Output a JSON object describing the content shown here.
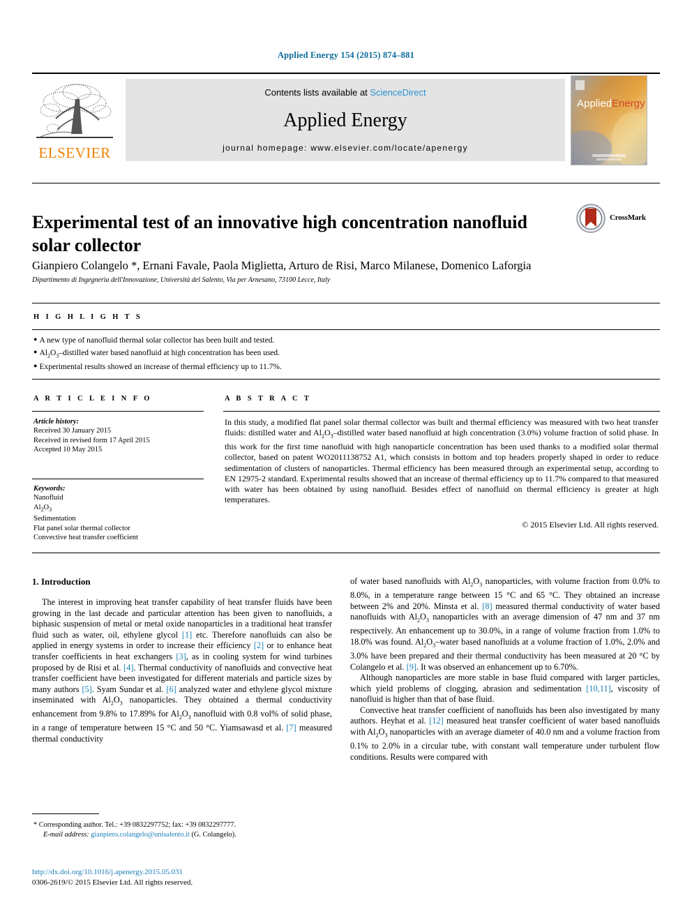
{
  "running_head": "Applied Energy 154 (2015) 874–881",
  "masthead": {
    "contents_prefix": "Contents lists available at ",
    "sciencedirect": "ScienceDirect",
    "journal_title": "Applied Energy",
    "homepage": "journal homepage: www.elsevier.com/locate/apenergy",
    "publisher_logo_text": "ELSEVIER",
    "cover_title_a": "Applied",
    "cover_title_b": "Energy"
  },
  "article": {
    "title": "Experimental test of an innovative high concentration nanofluid solar collector",
    "crossmark_label": "CrossMark",
    "authors": "Gianpiero Colangelo *, Ernani Favale, Paola Miglietta, Arturo de Risi, Marco Milanese, Domenico Laforgia",
    "affiliation": "Dipartimento di Ingegneria dell'Innovazione, Università del Salento, Via per Arnesano, 73100 Lecce, Italy"
  },
  "highlights": {
    "heading": "H I G H L I G H T S",
    "items": [
      "A new type of nanofluid thermal solar collector has been built and tested.",
      "Al2O3–distilled water based nanofluid at high concentration has been used.",
      "Experimental results showed an increase of thermal efficiency up to 11.7%."
    ]
  },
  "article_info": {
    "heading": "A R T I C L E   I N F O",
    "history_label": "Article history:",
    "history": [
      "Received 30 January 2015",
      "Received in revised form 17 April 2015",
      "Accepted 10 May 2015"
    ],
    "keywords_label": "Keywords:",
    "keywords": [
      "Nanofluid",
      "Al2O3",
      "Sedimentation",
      "Flat panel solar thermal collector",
      "Convective heat transfer coefficient"
    ]
  },
  "abstract": {
    "heading": "A B S T R A C T",
    "text": "In this study, a modified flat panel solar thermal collector was built and thermal efficiency was measured with two heat transfer fluids: distilled water and Al2O3–distilled water based nanofluid at high concentration (3.0%) volume fraction of solid phase. In this work for the first time nanofluid with high nanoparticle concentration has been used thanks to a modified solar thermal collector, based on patent WO2011138752 A1, which consists in bottom and top headers properly shaped in order to reduce sedimentation of clusters of nanoparticles. Thermal efficiency has been measured through an experimental setup, according to EN 12975-2 standard. Experimental results showed that an increase of thermal efficiency up to 11.7% compared to that measured with water has been obtained by using nanofluid. Besides effect of nanofluid on thermal efficiency is greater at high temperatures.",
    "copyright": "© 2015 Elsevier Ltd. All rights reserved."
  },
  "body": {
    "section_title": "1. Introduction",
    "left_paragraph_1": "The interest in improving heat transfer capability of heat transfer fluids have been growing in the last decade and particular attention has been given to nanofluids, a biphasic suspension of metal or metal oxide nanoparticles in a traditional heat transfer fluid such as water, oil, ethylene glycol [1] etc. Therefore nanofluids can also be applied in energy systems in order to increase their efficiency [2] or to enhance heat transfer coefficients in heat exchangers [3], as in cooling system for wind turbines proposed by de Risi et al. [4]. Thermal conductivity of nanofluids and convective heat transfer coefficient have been investigated for different materials and particle sizes by many authors [5]. Syam Sundar et al. [6] analyzed water and ethylene glycol mixture inseminated with Al2O3 nanoparticles. They obtained a thermal conductivity enhancement from 9.8% to 17.89% for Al2O3 nanofluid with 0.8 vol% of solid phase, in a range of temperature between 15 °C and 50 °C. Yiamsawasd et al. [7] measured thermal conductivity",
    "right_paragraph_1": "of water based nanofluids with Al2O3 nanoparticles, with volume fraction from 0.0% to 8.0%, in a temperature range between 15 °C and 65 °C. They obtained an increase between 2% and 20%. Minsta et al. [8] measured thermal conductivity of water based nanofluids with Al2O3 nanoparticles with an average dimension of 47 nm and 37 nm respectively. An enhancement up to 30.0%, in a range of volume fraction from 1.0% to 18.0% was found. Al2O3–water based nanofluids at a volume fraction of 1.0%, 2.0% and 3.0% have been prepared and their thermal conductivity has been measured at 20 °C by Colangelo et al. [9]. It was observed an enhancement up to 6.70%.",
    "right_paragraph_2": "Although nanoparticles are more stable in base fluid compared with larger particles, which yield problems of clogging, abrasion and sedimentation [10,11], viscosity of nanofluid is higher than that of base fluid.",
    "right_paragraph_3": "Convective heat transfer coefficient of nanofluids has been also investigated by many authors. Heyhat et al. [12] measured heat transfer coefficient of water based nanofluids with Al2O3 nanoparticles with an average diameter of 40.0 nm and a volume fraction from 0.1% to 2.0% in a circular tube, with constant wall temperature under turbulent flow conditions. Results were compared with"
  },
  "footnote": {
    "corresponding": "* Corresponding author. Tel.: +39 0832297752; fax: +39 0832297777.",
    "email_label": "E-mail address:",
    "email": "gianpiero.colangelo@unisalento.it",
    "email_suffix": "(G. Colangelo).",
    "doi": "http://dx.doi.org/10.1016/j.apenergy.2015.05.031",
    "issn_line": "0306-2619/© 2015 Elsevier Ltd. All rights reserved."
  },
  "colors": {
    "link": "#1a7fb5",
    "running_head": "#0b6b9a",
    "elsevier_orange": "#f08000",
    "banner_bg": "#e4e4e4"
  }
}
